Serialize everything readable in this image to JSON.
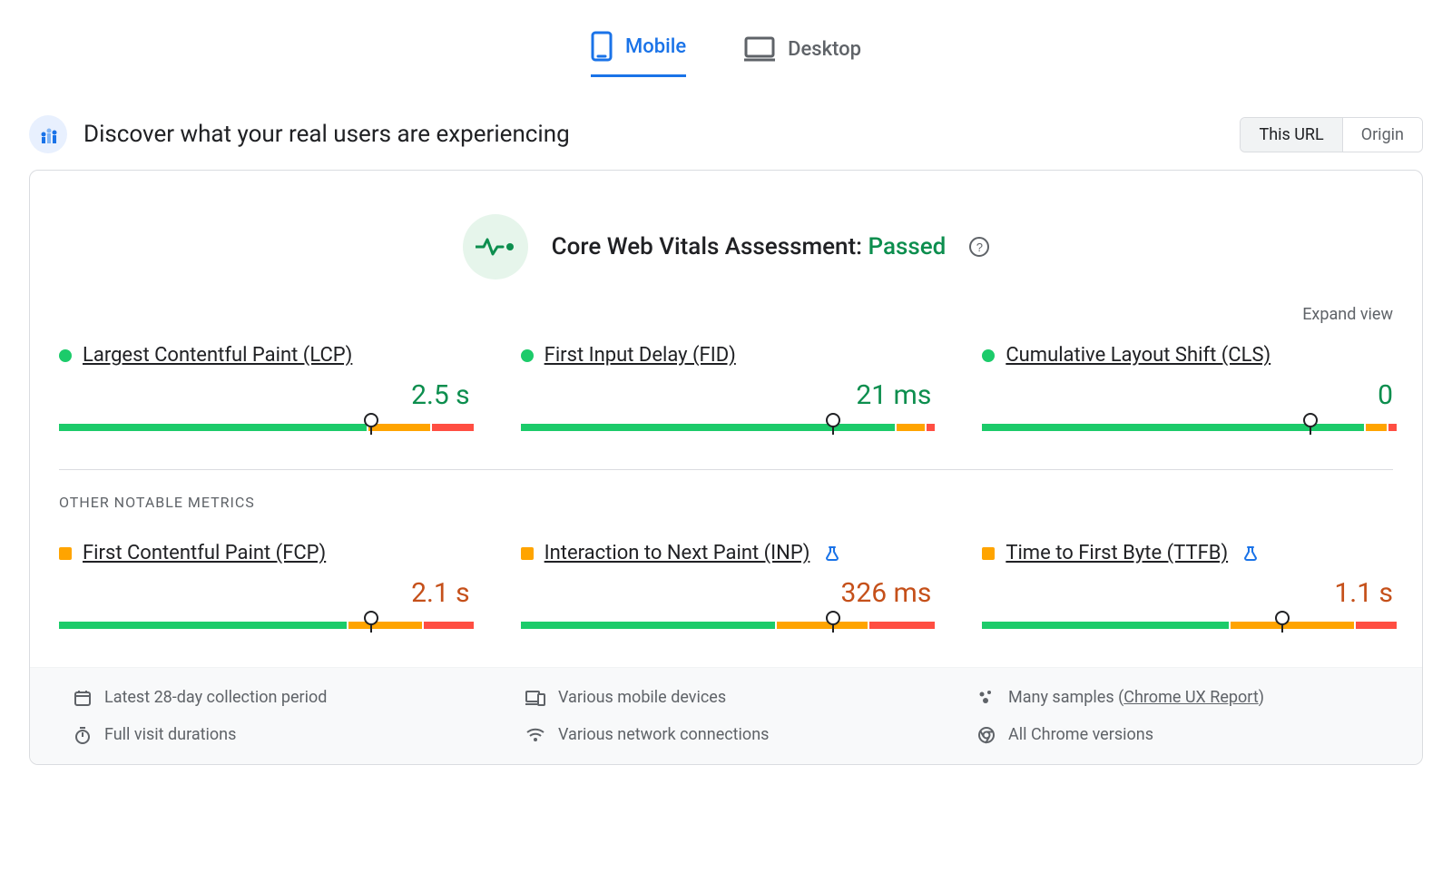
{
  "tabs": {
    "mobile": "Mobile",
    "desktop": "Desktop",
    "active": "mobile"
  },
  "header": {
    "title": "Discover what your real users are experiencing",
    "scope_this_url": "This URL",
    "scope_origin": "Origin",
    "scope_active": "this_url"
  },
  "assessment": {
    "label_prefix": "Core Web Vitals Assessment: ",
    "result": "Passed"
  },
  "expand_label": "Expand view",
  "section_other": "OTHER NOTABLE METRICS",
  "metrics": {
    "lcp": {
      "name": "Largest Contentful Paint (LCP)",
      "value": "2.5 s",
      "status": "green",
      "bar": {
        "green": 75,
        "amber": 15,
        "red": 10,
        "marker": 76
      }
    },
    "fid": {
      "name": "First Input Delay (FID)",
      "value": "21 ms",
      "status": "green",
      "bar": {
        "green": 91,
        "amber": 7,
        "red": 2,
        "marker": 76
      }
    },
    "cls": {
      "name": "Cumulative Layout Shift (CLS)",
      "value": "0",
      "status": "green",
      "bar": {
        "green": 93,
        "amber": 5,
        "red": 2,
        "marker": 80
      }
    },
    "fcp": {
      "name": "First Contentful Paint (FCP)",
      "value": "2.1 s",
      "status": "amber",
      "bar": {
        "green": 70,
        "amber": 18,
        "red": 12,
        "marker": 76
      }
    },
    "inp": {
      "name": "Interaction to Next Paint (INP)",
      "value": "326 ms",
      "status": "amber",
      "experimental": true,
      "bar": {
        "green": 62,
        "amber": 22,
        "red": 16,
        "marker": 76
      }
    },
    "ttfb": {
      "name": "Time to First Byte (TTFB)",
      "value": "1.1 s",
      "status": "amber",
      "experimental": true,
      "bar": {
        "green": 60,
        "amber": 30,
        "red": 10,
        "marker": 73
      }
    }
  },
  "footer": {
    "period": "Latest 28-day collection period",
    "devices": "Various mobile devices",
    "samples_prefix": "Many samples (",
    "samples_link": "Chrome UX Report",
    "samples_suffix": ")",
    "durations": "Full visit durations",
    "network": "Various network connections",
    "versions": "All Chrome versions"
  }
}
